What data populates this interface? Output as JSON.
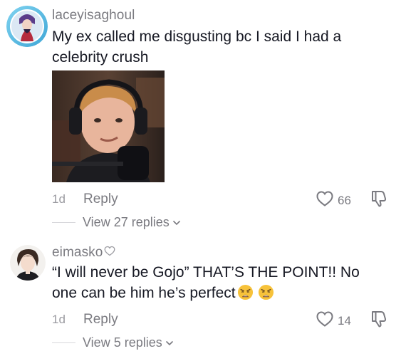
{
  "comments": [
    {
      "username": "laceyisaghoul",
      "text": "My ex called me disgusting bc I said I had a celebrity crush",
      "age": "1d",
      "reply_label": "Reply",
      "likes": "66",
      "view_replies": "View 27 replies",
      "avatar_icon": "user-avatar-blue-ring",
      "image_icon": "photo-person-headphones-microphone"
    },
    {
      "username": "eimasko",
      "text": "“I will never be Gojo” THAT’S THE POINT!! No one can be him he’s perfect",
      "age": "1d",
      "reply_label": "Reply",
      "likes": "14",
      "view_replies": "View 5 replies",
      "avatar_icon": "user-avatar-anime",
      "username_badge_icon": "heart-outline-icon",
      "trailing_emoji_icon": "weary-face-emoji"
    }
  ],
  "colors": {
    "text": "#161823",
    "muted": "#7a7a80",
    "emoji": "#f7c23a"
  }
}
